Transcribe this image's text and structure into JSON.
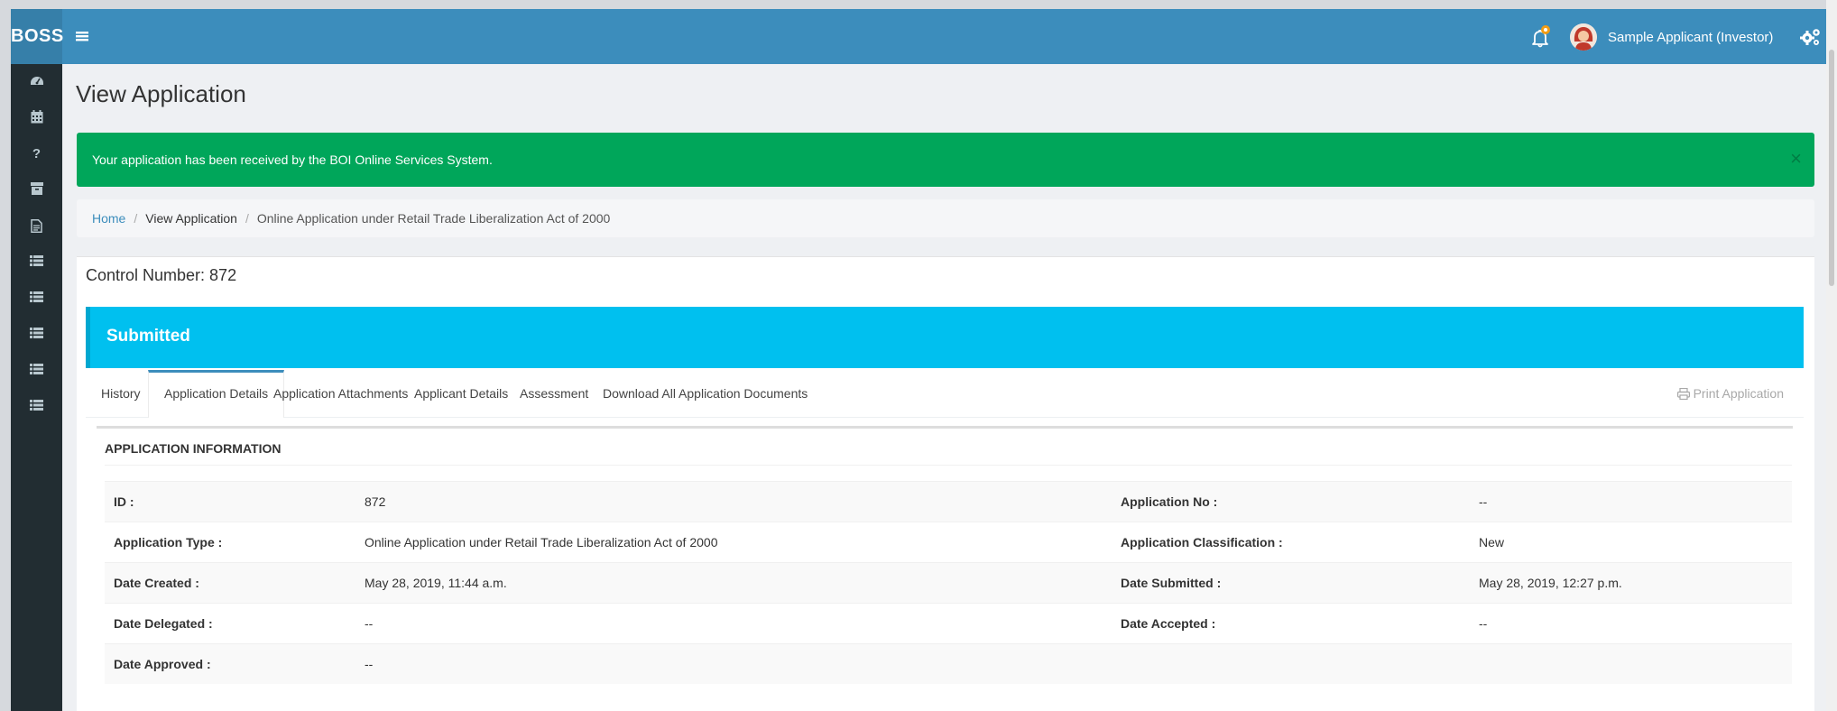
{
  "app": {
    "logo": "BOSS"
  },
  "header": {
    "username": "Sample Applicant (Investor)"
  },
  "sidebar": {
    "icons": [
      "dashboard-icon",
      "calendar-icon",
      "question-icon",
      "archive-icon",
      "document-icon",
      "list-icon",
      "list-icon",
      "list-icon",
      "list-icon",
      "list-icon"
    ]
  },
  "page": {
    "title": "View Application"
  },
  "alert": {
    "message": "Your application has been received by the BOI Online Services System.",
    "close": "×"
  },
  "breadcrumb": {
    "home": "Home",
    "view": "View Application",
    "current": "Online Application under Retail Trade Liberalization Act of 2000"
  },
  "control_number": "Control Number: 872",
  "status": "Submitted",
  "tabs": {
    "history": "History",
    "details": "Application Details",
    "attachments": "Application Attachments",
    "applicant": "Applicant Details",
    "assessment": "Assessment",
    "download": "Download All Application Documents",
    "print": "Print Application"
  },
  "section_title": "APPLICATION INFORMATION",
  "info": {
    "id_label": "ID :",
    "id_value": "872",
    "app_no_label": "Application No :",
    "app_no_value": "--",
    "type_label": "Application Type :",
    "type_value": "Online Application under Retail Trade Liberalization Act of 2000",
    "class_label": "Application Classification :",
    "class_value": "New",
    "created_label": "Date Created :",
    "created_value": "May 28, 2019, 11:44 a.m.",
    "submitted_label": "Date Submitted :",
    "submitted_value": "May 28, 2019, 12:27 p.m.",
    "delegated_label": "Date Delegated :",
    "delegated_value": "--",
    "accepted_label": "Date Accepted :",
    "accepted_value": "--",
    "approved_label": "Date Approved :",
    "approved_value": "--"
  },
  "colors": {
    "header": "#3c8dbc",
    "sidebar": "#222d32",
    "success": "#00a65a",
    "info": "#00c0ef"
  }
}
